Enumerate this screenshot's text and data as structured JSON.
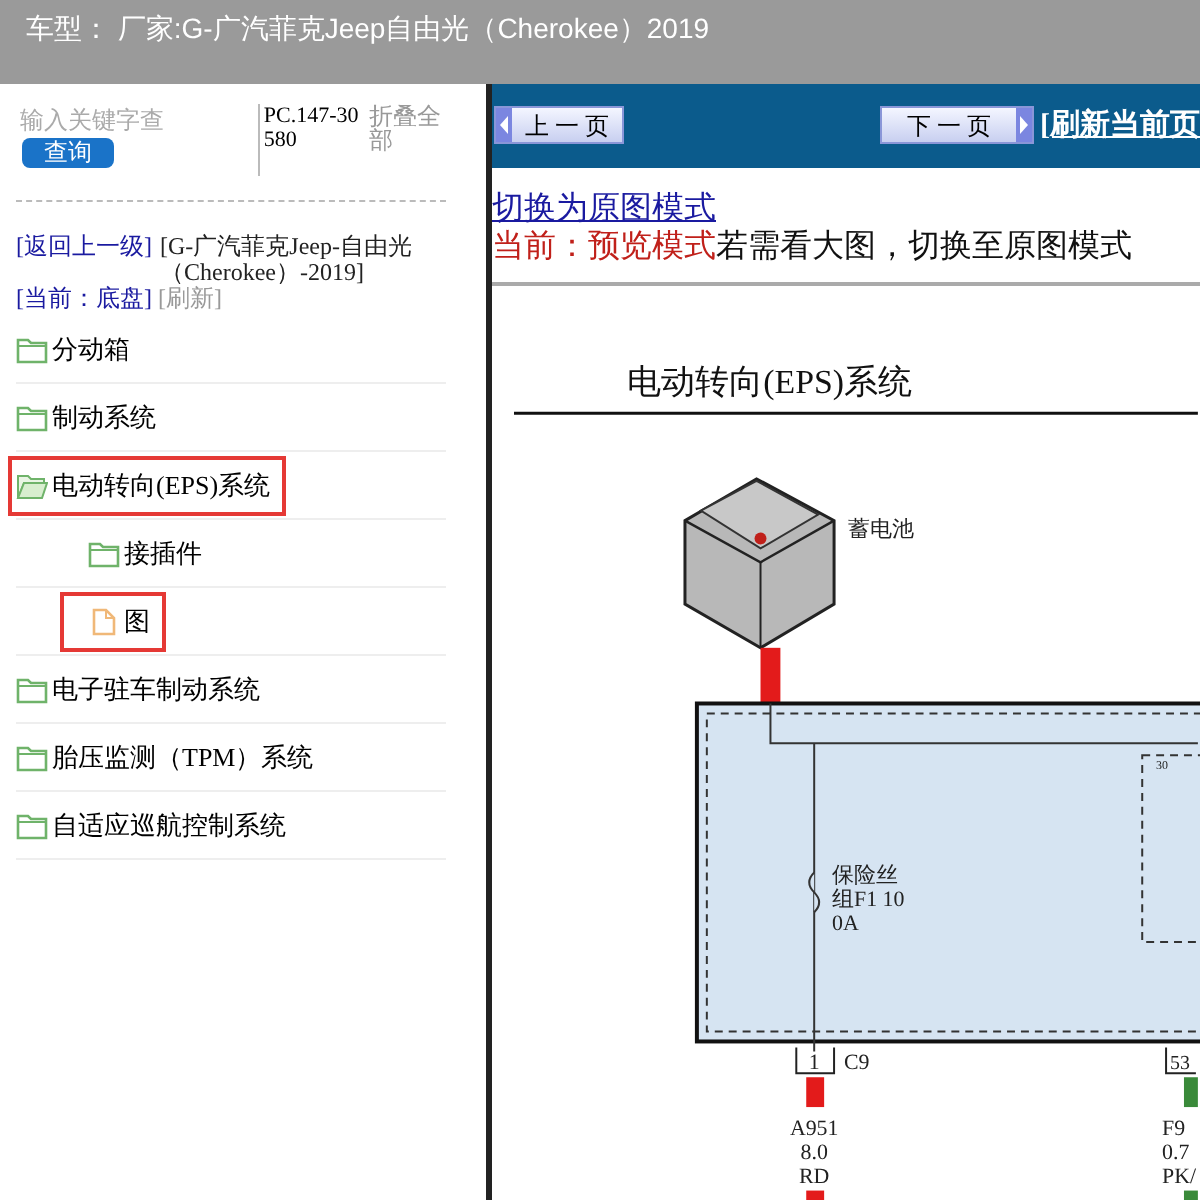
{
  "header": {
    "title": "车型：  厂家:G-广汽菲克Jeep自由光（Cherokee）2019"
  },
  "sidebar": {
    "search": {
      "placeholder": "输入关键字查",
      "button": "查询"
    },
    "code": "PC.147-30580",
    "collapse_all": "折叠全部",
    "breadcrumb": {
      "back": "[返回上一级]",
      "model": "[G-广汽菲克Jeep-自由光（Cherokee）-2019]",
      "current": "[当前：底盘]",
      "refresh": "[刷新]"
    },
    "tree": [
      {
        "label": "分动箱",
        "kind": "folder",
        "expanded": false,
        "highlighted": false
      },
      {
        "label": "制动系统",
        "kind": "folder",
        "expanded": false,
        "highlighted": false
      },
      {
        "label": "电动转向(EPS)系统",
        "kind": "folder",
        "expanded": true,
        "highlighted": true,
        "children": [
          {
            "label": "接插件",
            "kind": "folder",
            "expanded": false,
            "highlighted": false
          },
          {
            "label": "图",
            "kind": "file",
            "highlighted": true
          }
        ]
      },
      {
        "label": "电子驻车制动系统",
        "kind": "folder",
        "expanded": false,
        "highlighted": false
      },
      {
        "label": "胎压监测（TPM）系统",
        "kind": "folder",
        "expanded": false,
        "highlighted": false
      },
      {
        "label": "自适应巡航控制系统",
        "kind": "folder",
        "expanded": false,
        "highlighted": false
      }
    ]
  },
  "main": {
    "nav": {
      "prev": "上 一 页",
      "next": "下 一 页",
      "refresh": "[刷新当前页"
    },
    "mode_link": "切换为原图模式",
    "mode_status": "当前：预览模式",
    "mode_hint": "若需看大图，切换至原图模式",
    "document": {
      "title": "电动转向(EPS)系统",
      "battery_label": "蓄电池",
      "relay_pin": "30",
      "fuse_label": [
        "保险丝",
        "组F1 10",
        "0A"
      ],
      "connector_pin": "1",
      "connector_id": "C9",
      "wire": [
        "A951",
        "8.0",
        "RD"
      ],
      "right_pin": "53",
      "right_wire": [
        "F9",
        "0.7",
        "PK/"
      ]
    }
  }
}
